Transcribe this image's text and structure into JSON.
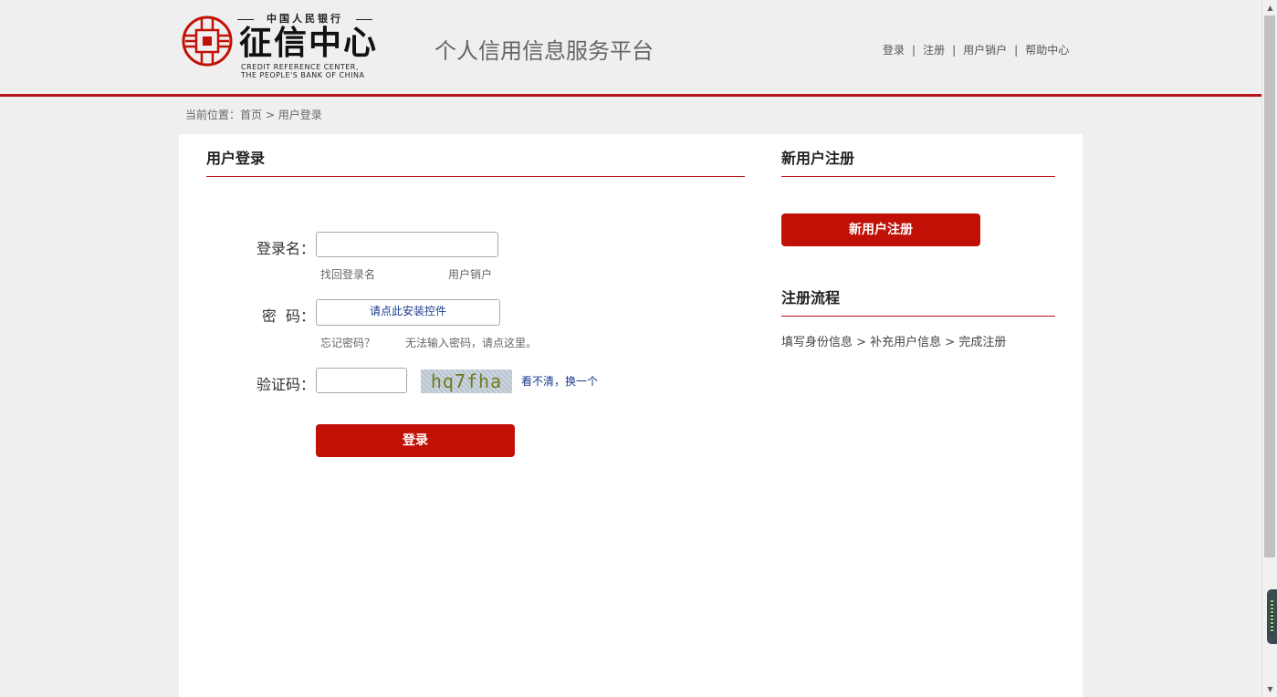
{
  "header": {
    "logo": {
      "top_text": "中国人民银行",
      "main_text": "征信中心",
      "en_line1": "CREDIT REFERENCE CENTER,",
      "en_line2": "THE PEOPLE'S BANK OF CHINA"
    },
    "platform_title": "个人信用信息服务平台",
    "nav": {
      "login": "登录",
      "register": "注册",
      "cancel_account": "用户销户",
      "help_center": "帮助中心",
      "separator": "|"
    }
  },
  "breadcrumb": {
    "prefix": "当前位置：",
    "home": "首页",
    "separator": " > ",
    "current": "用户登录"
  },
  "login": {
    "title": "用户登录",
    "username_label": "登录名：",
    "username_value": "",
    "find_username": "找回登录名",
    "cancel_account": "用户销户",
    "password_label": "密  码：",
    "password_control_text": "请点此安装控件",
    "forgot_password": "忘记密码？",
    "cannot_input_password": "无法输入密码，请点这里。",
    "captcha_label": "验证码：",
    "captcha_value": "",
    "captcha_text": "hq7fha",
    "captcha_refresh": "看不清，换一个",
    "submit_label": "登录"
  },
  "register": {
    "title": "新用户注册",
    "button_label": "新用户注册",
    "flow_title": "注册流程",
    "flow_text": "填写身份信息 > 补充用户信息 > 完成注册"
  },
  "colors": {
    "brand_red": "#c11107",
    "header_line": "#b8151b",
    "link_blue": "#1a3a8e",
    "page_bg": "#efefef"
  }
}
